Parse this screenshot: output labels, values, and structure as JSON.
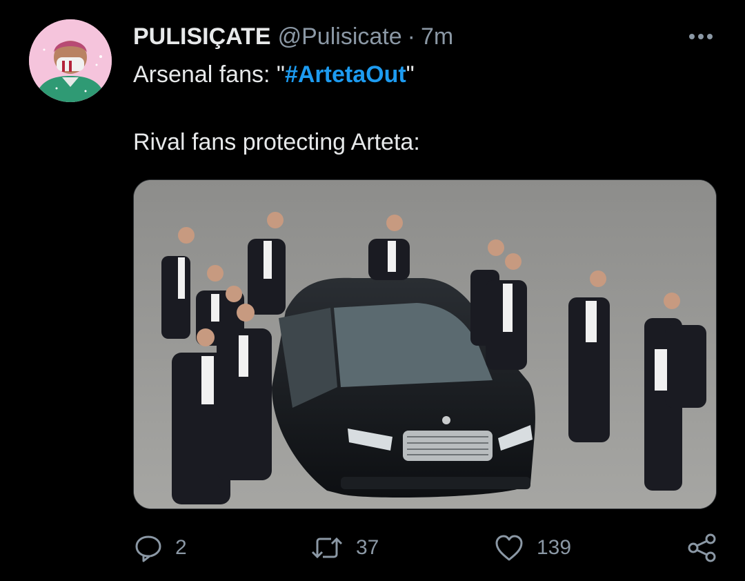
{
  "tweet": {
    "author": {
      "display_name": "PULISIÇATE",
      "handle": "@Pulisicate",
      "separator": "·",
      "time": "7m"
    },
    "text": {
      "line1_prefix": "Arsenal fans: \"",
      "hashtag": "#ArtetaOut",
      "line1_suffix": "\"",
      "line2": "Rival fans protecting Arteta:"
    },
    "media": {
      "description_icon": "photo"
    },
    "actions": {
      "reply_count": "2",
      "retweet_count": "37",
      "like_count": "139"
    }
  },
  "colors": {
    "background": "#000000",
    "text_primary": "#e7e9ea",
    "text_secondary": "#8b98a5",
    "accent": "#1d9bf0"
  },
  "icons": {
    "reply": "speech-bubble-icon",
    "retweet": "retweet-arrows-icon",
    "like": "heart-icon",
    "share": "share-nodes-icon",
    "more": "ellipsis-icon"
  }
}
